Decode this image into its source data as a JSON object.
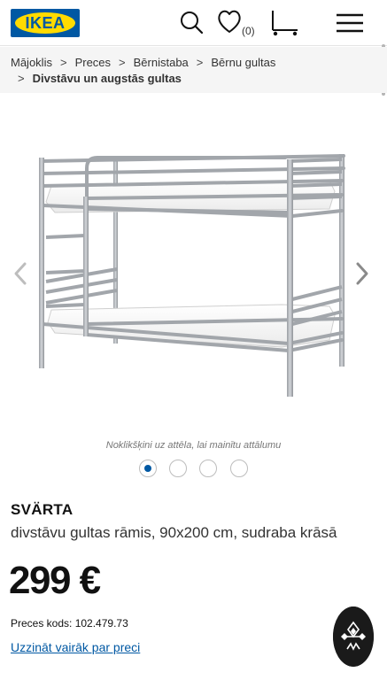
{
  "header": {
    "logo_text": "IKEA",
    "favorites_count": "(0)",
    "icons": [
      "search-icon",
      "heart-icon",
      "cart-icon",
      "menu-icon"
    ],
    "colors": {
      "brand_blue": "#0058a3",
      "brand_yellow": "#ffdb00"
    }
  },
  "breadcrumb": {
    "items": [
      "Mājoklis",
      "Preces",
      "Bērnistaba",
      "Bērnu gultas"
    ],
    "current": "Divstāvu un augstās gultas",
    "separator": ">"
  },
  "gallery": {
    "caption": "Noklikšķini uz attēla, lai mainītu attālumu",
    "dot_count": 4,
    "active_dot": 0,
    "prev_icon": "chevron-left-icon",
    "next_icon": "chevron-right-icon"
  },
  "product": {
    "name": "SVÄRTA",
    "description": "divstāvu gultas rāmis, 90x200 cm, sudraba krāsā",
    "price": "299 €",
    "article": "Preces kods: 102.479.73",
    "learn_more": "Uzzināt vairāk par preci"
  }
}
